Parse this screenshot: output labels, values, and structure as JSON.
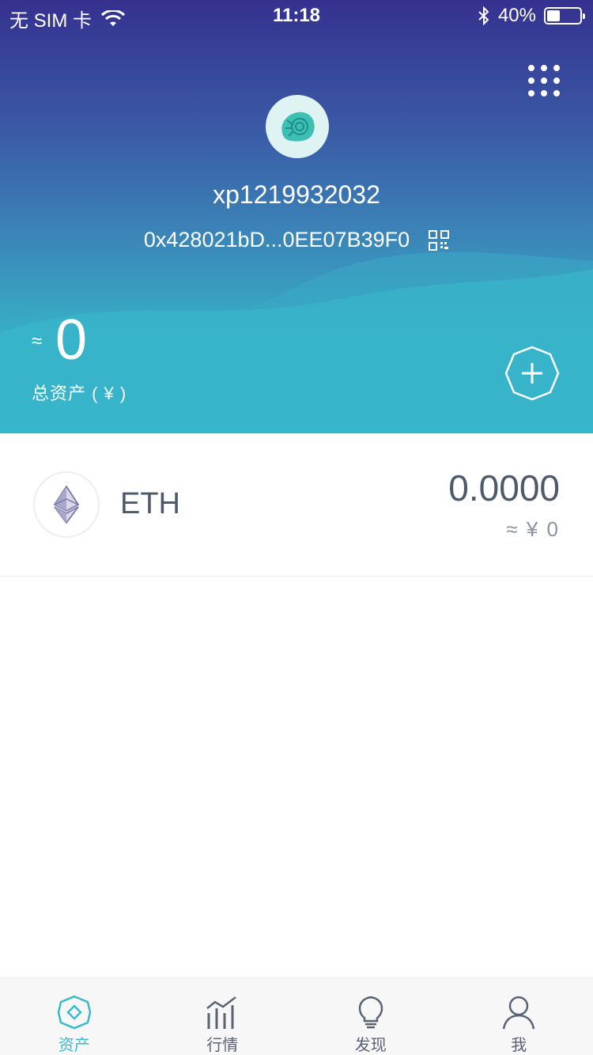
{
  "status_bar": {
    "carrier": "无 SIM 卡",
    "time": "11:18",
    "battery_percent": "40%",
    "battery_level": 0.4
  },
  "header": {
    "wallet_name": "xp1219932032",
    "address": "0x428021bD...0EE07B39F0",
    "total_approx_symbol": "≈",
    "total_value": "0",
    "total_label": "总资产 ( ¥ )"
  },
  "assets": [
    {
      "symbol": "ETH",
      "balance": "0.0000",
      "fiat": "≈ ¥ 0",
      "icon": "ethereum-icon"
    }
  ],
  "tab_bar": {
    "tabs": [
      {
        "label": "资产",
        "icon": "asset-diamond-icon",
        "active": true
      },
      {
        "label": "行情",
        "icon": "market-chart-icon",
        "active": false
      },
      {
        "label": "发现",
        "icon": "discover-bulb-icon",
        "active": false
      },
      {
        "label": "我",
        "icon": "profile-icon",
        "active": false
      }
    ]
  },
  "colors": {
    "accent": "#36bcc9",
    "header_top": "#35318f",
    "header_bottom": "#36bdc9",
    "text_dark": "#4e5a6b"
  }
}
